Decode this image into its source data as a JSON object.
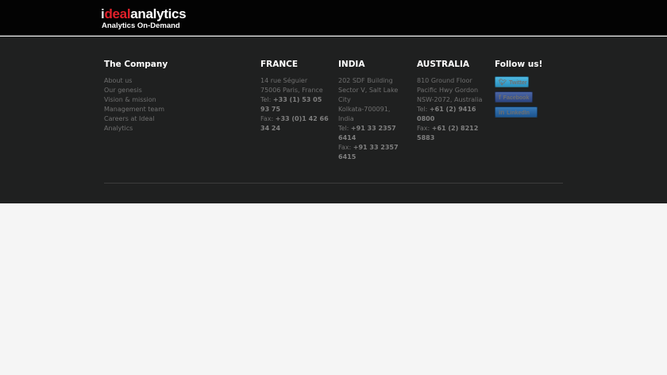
{
  "header": {
    "logo": {
      "i": "i",
      "deal": "deal",
      "analytics": "analytics",
      "tagline": "Analytics On-Demand"
    }
  },
  "company": {
    "title": "The Company",
    "links": [
      "About us",
      "Our genesis",
      "Vision & mission",
      "Management team",
      "Careers at Ideal Analytics"
    ]
  },
  "france": {
    "title": "FRANCE",
    "address": [
      "14 rue Séguier",
      "75006 Paris, France"
    ],
    "tel_label": "Tel:",
    "tel": "+33 (1) 53 05 93 75",
    "fax_label": "Fax:",
    "fax": "+33 (0)1 42 66 34 24"
  },
  "india": {
    "title": "INDIA",
    "address": [
      "202 SDF Building",
      "Sector V, Salt Lake City",
      "Kolkata-700091, India"
    ],
    "tel_label": "Tel:",
    "tel": "+91 33 2357 6414",
    "fax_label": "Fax:",
    "fax": "+91 33 2357 6415"
  },
  "australia": {
    "title": "AUSTRALIA",
    "address": [
      "810 Ground Floor",
      "Pacific Hwy Gordon",
      "NSW-2072, Australia"
    ],
    "tel_label": "Tel:",
    "tel": "+61 (2) 9416 0800",
    "fax_label": "Fax:",
    "fax": "+61 (2) 8212 5883"
  },
  "follow": {
    "title": "Follow us!",
    "twitter": "Twitter",
    "facebook": "Facebook",
    "linkedin": "LinkedIn"
  }
}
